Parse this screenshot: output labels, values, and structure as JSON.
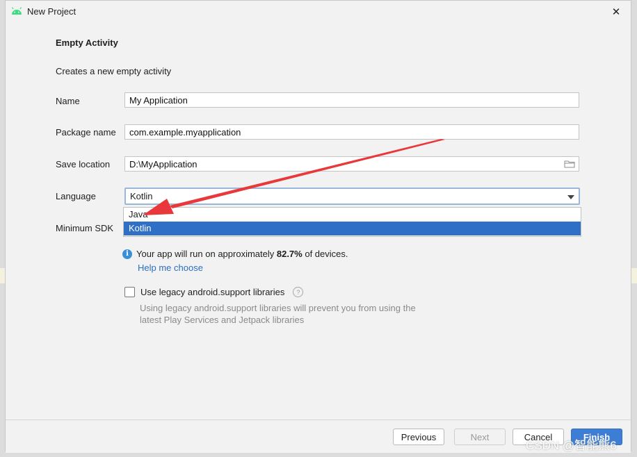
{
  "window": {
    "title": "New Project",
    "close_glyph": "✕",
    "app_icon": "android-icon"
  },
  "form": {
    "heading": "Empty Activity",
    "description": "Creates a new empty activity",
    "name_label": "Name",
    "name_value": "My Application",
    "package_label": "Package name",
    "package_value": "com.example.myapplication",
    "location_label": "Save location",
    "location_value": "D:\\MyApplication",
    "language_label": "Language",
    "language_value": "Kotlin",
    "language_options": [
      "Java",
      "Kotlin"
    ],
    "language_selected_option": "Kotlin",
    "min_sdk_label": "Minimum SDK",
    "info_prefix": "Your app will run on approximately ",
    "info_percent": "82.7%",
    "info_suffix": " of devices.",
    "help_link": "Help me choose",
    "legacy_label": "Use legacy android.support libraries",
    "legacy_checked": false,
    "legacy_hint": "Using legacy android.support libraries will prevent you from using the latest Play Services and Jetpack libraries",
    "question_glyph": "?"
  },
  "footer": {
    "previous": "Previous",
    "next": "Next",
    "cancel": "Cancel",
    "finish": "Finish"
  },
  "annotation": {
    "arrow_color": "#e8383b"
  },
  "watermark": "CSDN @智能熊6",
  "colors": {
    "selection": "#2f6fc5",
    "link": "#2a6fc0",
    "primary_button": "#3d7dd3",
    "android_green": "#3ddc84"
  }
}
